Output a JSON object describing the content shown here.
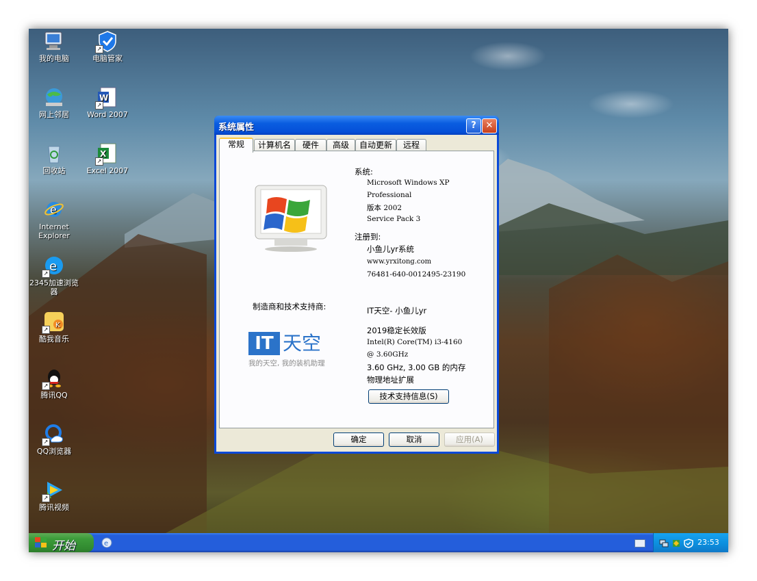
{
  "desktop": {
    "icons": [
      {
        "label": "我的电脑",
        "icon": "my-computer-icon"
      },
      {
        "label": "电脑管家",
        "icon": "pc-manager-icon"
      },
      {
        "label": "网上邻居",
        "icon": "network-places-icon"
      },
      {
        "label": "Word 2007",
        "icon": "word-icon"
      },
      {
        "label": "回收站",
        "icon": "recycle-bin-icon"
      },
      {
        "label": "Excel 2007",
        "icon": "excel-icon"
      },
      {
        "label": "Internet Explorer",
        "icon": "ie-icon"
      },
      {
        "label": "2345加速浏览器",
        "icon": "browser-2345-icon"
      },
      {
        "label": "酷我音乐",
        "icon": "kuwo-music-icon"
      },
      {
        "label": "腾讯QQ",
        "icon": "qq-icon"
      },
      {
        "label": "QQ浏览器",
        "icon": "qq-browser-icon"
      },
      {
        "label": "腾讯视频",
        "icon": "tencent-video-icon"
      }
    ]
  },
  "dialog": {
    "title": "系统属性",
    "help": "?",
    "close": "✕",
    "tabs": [
      "常规",
      "计算机名",
      "硬件",
      "高级",
      "自动更新",
      "远程"
    ],
    "system_heading": "系统:",
    "os_line1": "Microsoft Windows XP",
    "os_line2": "Professional",
    "version": "版本 2002",
    "service_pack": "Service Pack 3",
    "registered_heading": "注册到:",
    "registered_user": "小鱼儿yr系统",
    "registered_site": "www.yrxitong.com",
    "product_id": "76481-640-0012495-23190",
    "manufacturer_heading": "制造商和技术支持商:",
    "manufacturer_name": "IT天空- 小鱼儿yr",
    "edition": "2019稳定长效版",
    "cpu_line1": "Intel(R) Core(TM) i3-4160",
    "cpu_line2": "@ 3.60GHz",
    "cpu_memory": "3.60 GHz, 3.00 GB 的内存",
    "pae": "物理地址扩展",
    "logo_text_it": "IT",
    "logo_text_cn": "天空",
    "logo_slogan": "我的天空, 我的装机助理",
    "support_button": "技术支持信息(S)",
    "ok_button": "确定",
    "cancel_button": "取消",
    "apply_button": "应用(A)"
  },
  "taskbar": {
    "start_label": "开始",
    "clock": "23:53"
  },
  "colors": {
    "titlebar": "#0a5de0",
    "start_green": "#3c9c3a",
    "taskbar_blue": "#245edb",
    "dialog_face": "#ece9d8",
    "it_logo_blue": "#2b73c9"
  }
}
